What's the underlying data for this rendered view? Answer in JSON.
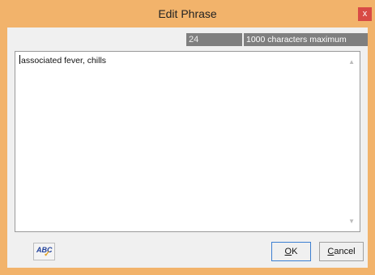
{
  "window": {
    "title": "Edit Phrase",
    "close_glyph": "x"
  },
  "counter": {
    "count": "24",
    "max_label": "1000 characters maximum"
  },
  "editor": {
    "text": "associated fever, chills",
    "scroll_up": "^",
    "scroll_down": "v"
  },
  "spell_check": {
    "label": "ABC",
    "icon": "spell-check-icon"
  },
  "buttons": {
    "ok_label": "OK",
    "cancel_label": "Cancel"
  },
  "colors": {
    "frame": "#f2b36b",
    "close": "#d84a45",
    "counter_bg": "#7f7f7f"
  }
}
